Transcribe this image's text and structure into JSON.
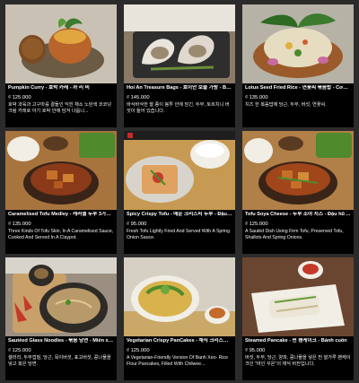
{
  "items": [
    {
      "name": "Pumpkin Curry - 호박 카레 - 까 리 비",
      "price": "₫ 125.000",
      "desc": "호박 과육과 고구마를 곁들인 익힌 채소 노란색 코코넛 크림 카레로 아기 호박 안에 담겨 나옵니...",
      "palette": {
        "bg": "#c9c2b4",
        "plate": "#6b5a44",
        "food": "#b8642a",
        "accent": "#3c7a2e"
      }
    },
    {
      "name": "Hoi An Treasure Bags - 호이안 보물 가방 - Bao...",
      "price": "₫ 145.000",
      "desc": "바삭바삭한 쌀 종이 봉투 안에 담긴, 두부, 토르치니 버섯이 들어 있습니다.",
      "palette": {
        "bg": "#8a7a66",
        "plate": "#2e2e2e",
        "food": "#e9e4dc",
        "accent": "#6a8f3a"
      }
    },
    {
      "name": "Lotus Seed Fried Rice - 연꽃씨 볶음밥 - Cơm chiên...",
      "price": "₫ 135.000",
      "desc": "치즈 한 볶음밥에 당근, 두부, 버섯, 연꽃씨.",
      "palette": {
        "bg": "#b7b2a6",
        "plate": "#9a5a2a",
        "food": "#e6dcc0",
        "accent": "#4a8a2e"
      }
    },
    {
      "name": "Caramelised Tofu Medley - 캐러멜 두부 3가지 - ...",
      "price": "₫ 135.000",
      "desc": "Three Kinds Of Tofu Skin, In A Caramelised Sauce, Cooked And Served In A Claypot.",
      "palette": {
        "bg": "#a8743e",
        "plate": "#3a2418",
        "food": "#8a3a18",
        "accent": "#4f8a2c"
      }
    },
    {
      "name": "Spicy Crispy Tofu - 매운 크리스피 두부 - Đậu ...",
      "price": "₫ 95.000",
      "desc": "Fresh Tofu Lightly Fried And Served With A Spring Onion Sauce.",
      "palette": {
        "bg": "#c69a52",
        "plate": "#d8d4cc",
        "food": "#e0a260",
        "accent": "#4a8a2a"
      }
    },
    {
      "name": "Tofu Soya Cheese - 두부 소야 치즈 - Đậu hũ ...",
      "price": "₫ 125.000",
      "desc": "A Sautéd Dish Using Firm Tofu, Preserved Tofu, Shallots And Spring Onions.",
      "palette": {
        "bg": "#b08048",
        "plate": "#3a2418",
        "food": "#c4702a",
        "accent": "#4f8a2c"
      }
    },
    {
      "name": "Sautéed Glass Noodles - 볶음 당면 - Miến xào ...",
      "price": "₫ 125.000",
      "desc": "셀러리, 두부껍질, 당근, 목이버섯, 표고버섯, 콩나물을 넣고 볶은 당면.",
      "palette": {
        "bg": "#9a8f80",
        "plate": "#2e2a26",
        "food": "#c9a06a",
        "accent": "#c43a2a"
      }
    },
    {
      "name": "Vegetarian Crispy PanCakes - 채식 크리스피 ...",
      "price": "₫ 125.000",
      "desc": "A Vegetarian-Friendly Version Of Banh Xeo- Rice Flour Pancakes, Filled With Chilwee...",
      "palette": {
        "bg": "#d6d0c4",
        "plate": "#f1eee6",
        "food": "#d8b24a",
        "accent": "#4f8a2c"
      }
    },
    {
      "name": "Steamed Pancake - 찐 팬케이크 - Bánh cuốn",
      "price": "₫ 95.000",
      "desc": "버섯, 두부, 당근, 양파, 콩나물을 넣은 찐 쌀가루 팬케이크인 \"바인 꾸온\"의 채식 버전입니다.",
      "palette": {
        "bg": "#6a4630",
        "plate": "#f1eee6",
        "food": "#ece6d6",
        "accent": "#6a9a3a"
      }
    }
  ]
}
